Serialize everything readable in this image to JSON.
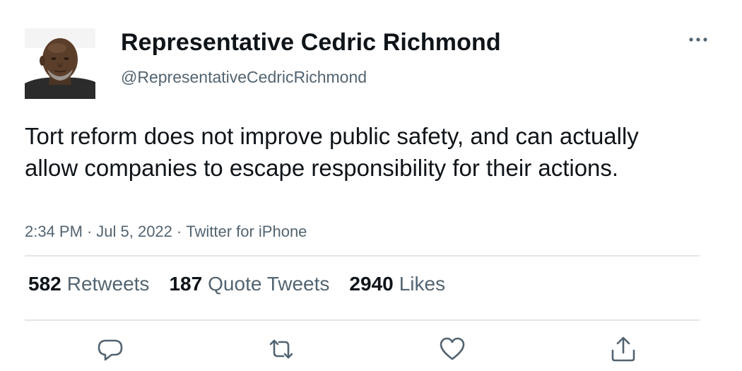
{
  "author": {
    "display_name": "Representative Cedric Richmond",
    "handle": "@RepresentativeCedricRichmond"
  },
  "tweet": {
    "text": "Tort reform does not improve public safety, and can actually allow companies to escape responsibility for their actions.",
    "time": "2:34 PM",
    "date": "Jul 5, 2022",
    "source": "Twitter for iPhone",
    "separator": "·"
  },
  "stats": {
    "retweets_count": "582",
    "retweets_label": "Retweets",
    "quotes_count": "187",
    "quotes_label": "Quote Tweets",
    "likes_count": "2940",
    "likes_label": "Likes"
  },
  "icons": {
    "more": "more-icon",
    "reply": "reply-icon",
    "retweet": "retweet-icon",
    "like": "like-icon",
    "share": "share-icon"
  },
  "colors": {
    "text_primary": "#0f1419",
    "text_secondary": "#536471",
    "divider": "#e1e6e9"
  }
}
